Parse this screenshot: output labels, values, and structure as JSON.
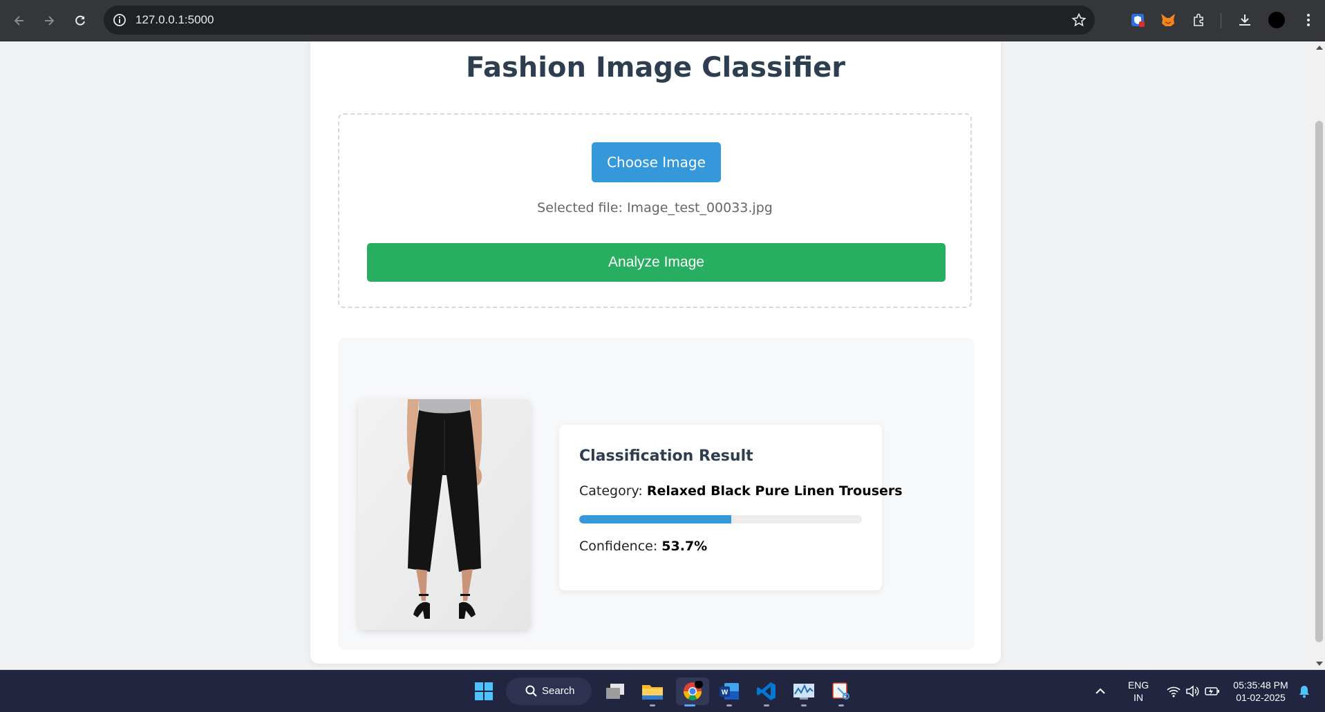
{
  "browser": {
    "url": "127.0.0.1:5000"
  },
  "page": {
    "title": "Fashion Image Classifier",
    "choose_button": "Choose Image",
    "selected_file_prefix": "Selected file:",
    "selected_file_name": "Image_test_00033.jpg",
    "analyze_button": "Analyze Image"
  },
  "result": {
    "title": "Classification Result",
    "category_label": "Category:",
    "category_value": "Relaxed Black Pure Linen Trousers",
    "confidence_label": "Confidence:",
    "confidence_value": "53.7%",
    "confidence_fraction": 0.537
  },
  "colors": {
    "primary_blue": "#3498db",
    "analyze_green": "#27ae60",
    "heading": "#2c3e50"
  },
  "taskbar": {
    "search_label": "Search",
    "apps": [
      "task-view",
      "file-explorer",
      "chrome",
      "word",
      "vscode",
      "resource-monitor",
      "snipping-tool"
    ],
    "language_line1": "ENG",
    "language_line2": "IN",
    "time": "05:35:48 PM",
    "date": "01-02-2025"
  }
}
